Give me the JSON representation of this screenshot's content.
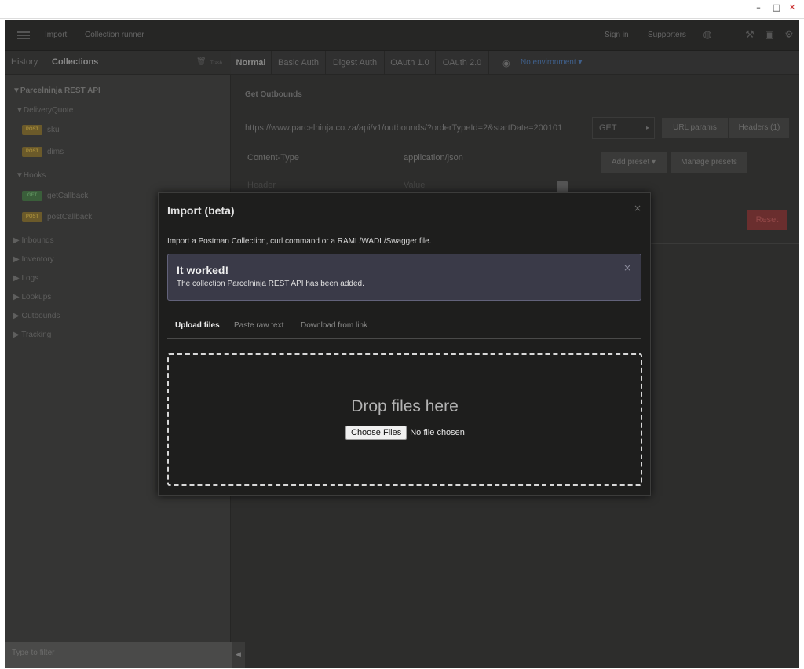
{
  "window": {
    "minimize_glyph": "–",
    "maximize_glyph": "□",
    "close_glyph": "✕"
  },
  "topnav": {
    "import": "Import",
    "collection_runner": "Collection runner",
    "sign_in": "Sign in",
    "supporters": "Supporters",
    "icons": [
      "globe-icon",
      "wrench-icon",
      "video-icon",
      "settings-icon"
    ]
  },
  "sidebar": {
    "tabs": {
      "history": "History",
      "collections": "Collections"
    },
    "trash_glyph": "🗑",
    "trash_label": "Trash",
    "collection_name": "Parcelninja REST API",
    "folders": [
      {
        "name": "DeliveryQuote",
        "requests": [
          {
            "method": "POST",
            "name": "sku"
          },
          {
            "method": "POST",
            "name": "dims"
          }
        ]
      },
      {
        "name": "Hooks",
        "requests": [
          {
            "method": "GET",
            "name": "getCallback"
          },
          {
            "method": "POST",
            "name": "postCallback"
          }
        ]
      }
    ],
    "collapsed_folders": [
      "Inbounds",
      "Inventory",
      "Logs",
      "Lookups",
      "Outbounds",
      "Tracking"
    ],
    "filter_placeholder": "Type to filter",
    "collapse_glyph": "◀"
  },
  "main": {
    "auth_tabs": [
      "Normal",
      "Basic Auth",
      "Digest Auth",
      "OAuth 1.0",
      "OAuth 2.0"
    ],
    "environment": "No environment ▾",
    "request_name": "Get Outbounds",
    "url": "https://www.parcelninja.co.za/api/v1/outbounds/?orderTypeId=2&startDate=200101",
    "method": "GET",
    "method_caret": "▸",
    "url_params": "URL params",
    "headers_btn": "Headers (1)",
    "header_key": "Content-Type",
    "header_value": "application/json",
    "header_key_placeholder": "Header",
    "header_value_placeholder": "Value",
    "add_preset": "Add preset ▾",
    "manage_presets": "Manage presets",
    "reset": "Reset"
  },
  "modal": {
    "title": "Import (beta)",
    "close_glyph": "×",
    "description": "Import a Postman Collection, curl command or a RAML/WADL/Swagger file.",
    "alert_title": "It worked!",
    "alert_message": "The collection Parcelninja REST API has been added.",
    "alert_close_glyph": "×",
    "tabs": [
      "Upload files",
      "Paste raw text",
      "Download from link"
    ],
    "drop_text": "Drop files here",
    "choose_files": "Choose Files",
    "no_file": "No file chosen"
  }
}
